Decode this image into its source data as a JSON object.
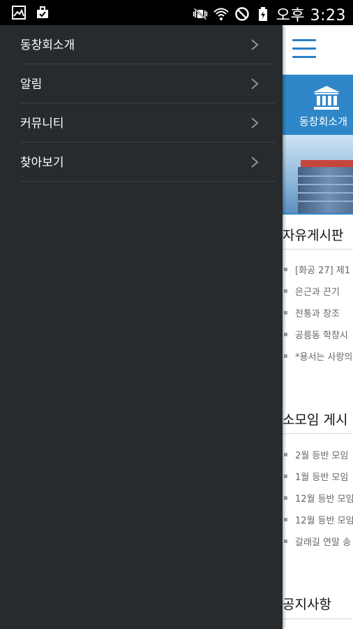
{
  "status_bar": {
    "time": "오후 3:23",
    "icons": [
      "gallery-icon",
      "briefcase-icon",
      "vibrate-icon",
      "wifi-icon",
      "do-not-disturb-icon",
      "battery-icon"
    ]
  },
  "drawer": {
    "items": [
      {
        "label": "동창회소개",
        "icon": "chevron-right-icon"
      },
      {
        "label": "알림",
        "icon": "chevron-right-icon"
      },
      {
        "label": "커뮤니티",
        "icon": "chevron-right-icon"
      },
      {
        "label": "찾아보기",
        "icon": "chevron-right-icon"
      }
    ]
  },
  "main": {
    "menu_icon": "hamburger-icon",
    "category_button": {
      "label": "동창회소개",
      "icon": "bank-icon"
    },
    "free_board": {
      "title": "자유게시판",
      "items": [
        "[화공 27] 제1",
        "은근과 끈기",
        "전통과 창조",
        "공릉동 학창시",
        "*용서는 사랑의"
      ]
    },
    "club_board": {
      "title": "소모임 게시",
      "items": [
        "2월 등반 모임",
        "1월 등반 모임",
        "12월 등반 모임",
        "12월 등반 모임",
        "갈래길 연말 송"
      ]
    },
    "notice": {
      "title": "공지사항"
    }
  },
  "colors": {
    "accent": "#2f87c9",
    "drawer_bg": "#272b2e",
    "status_bar": "#000000"
  }
}
